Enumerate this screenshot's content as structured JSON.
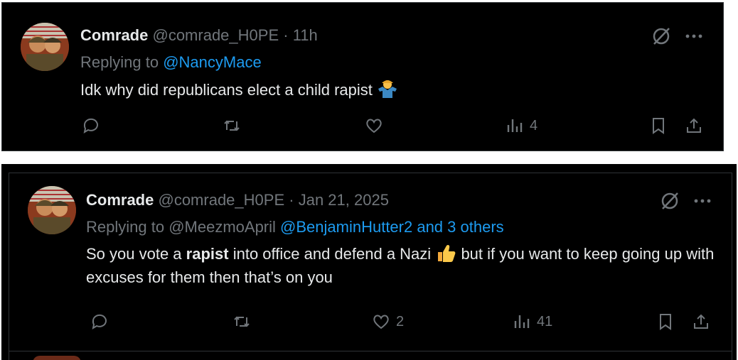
{
  "posts": [
    {
      "name": "Comrade",
      "handle": "@comrade_H0PE",
      "separator": "·",
      "time": "11h",
      "reply_prefix": "Replying to",
      "reply_mentions": [
        "@NancyMace"
      ],
      "text": "Idk why did republicans elect a child rapist",
      "emoji": "person-shrugging-emoji",
      "actions": {
        "reply": "",
        "repost": "",
        "like": "",
        "views": "4"
      }
    },
    {
      "name": "Comrade",
      "handle": "@comrade_H0PE",
      "separator": "·",
      "time": "Jan 21, 2025",
      "reply_prefix": "Replying to",
      "reply_plain_mention": "@MeezmoApril",
      "reply_link": "@BenjaminHutter2 and 3 others",
      "text_before": "So you vote a",
      "text_bold": "rapist",
      "text_middle": "into office and defend a Nazi",
      "emoji": "thumbs-up-emoji",
      "text_after": "but if you want to keep going up with excuses for them then that’s on you",
      "actions": {
        "reply": "",
        "repost": "",
        "like": "2",
        "views": "41"
      }
    }
  ],
  "colors": {
    "bg": "#000000",
    "text": "#e7e9ea",
    "muted": "#71767b",
    "link": "#1d9bf0",
    "divider": "#2f3336"
  }
}
